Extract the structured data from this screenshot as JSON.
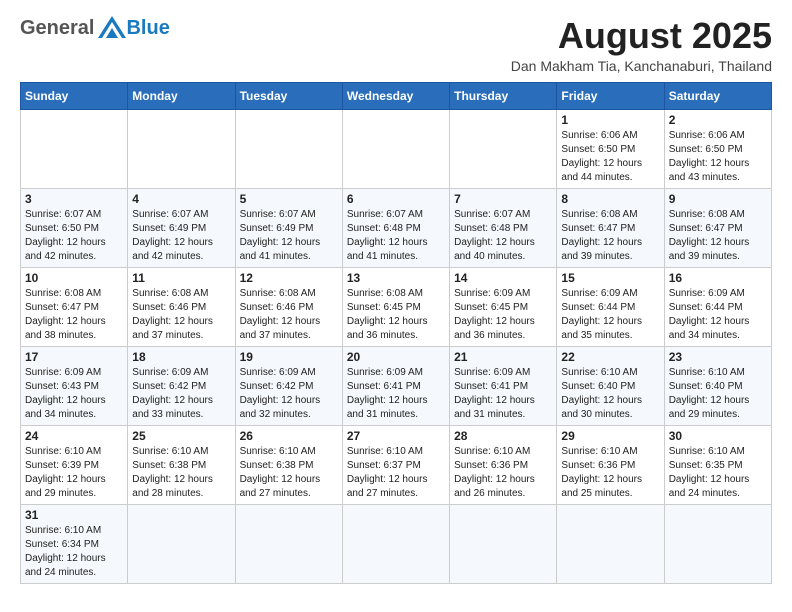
{
  "logo": {
    "general": "General",
    "blue": "Blue"
  },
  "header": {
    "month": "August 2025",
    "subtitle": "Dan Makham Tia, Kanchanaburi, Thailand"
  },
  "weekdays": [
    "Sunday",
    "Monday",
    "Tuesday",
    "Wednesday",
    "Thursday",
    "Friday",
    "Saturday"
  ],
  "weeks": [
    [
      {
        "day": "",
        "info": ""
      },
      {
        "day": "",
        "info": ""
      },
      {
        "day": "",
        "info": ""
      },
      {
        "day": "",
        "info": ""
      },
      {
        "day": "",
        "info": ""
      },
      {
        "day": "1",
        "info": "Sunrise: 6:06 AM\nSunset: 6:50 PM\nDaylight: 12 hours\nand 44 minutes."
      },
      {
        "day": "2",
        "info": "Sunrise: 6:06 AM\nSunset: 6:50 PM\nDaylight: 12 hours\nand 43 minutes."
      }
    ],
    [
      {
        "day": "3",
        "info": "Sunrise: 6:07 AM\nSunset: 6:50 PM\nDaylight: 12 hours\nand 42 minutes."
      },
      {
        "day": "4",
        "info": "Sunrise: 6:07 AM\nSunset: 6:49 PM\nDaylight: 12 hours\nand 42 minutes."
      },
      {
        "day": "5",
        "info": "Sunrise: 6:07 AM\nSunset: 6:49 PM\nDaylight: 12 hours\nand 41 minutes."
      },
      {
        "day": "6",
        "info": "Sunrise: 6:07 AM\nSunset: 6:48 PM\nDaylight: 12 hours\nand 41 minutes."
      },
      {
        "day": "7",
        "info": "Sunrise: 6:07 AM\nSunset: 6:48 PM\nDaylight: 12 hours\nand 40 minutes."
      },
      {
        "day": "8",
        "info": "Sunrise: 6:08 AM\nSunset: 6:47 PM\nDaylight: 12 hours\nand 39 minutes."
      },
      {
        "day": "9",
        "info": "Sunrise: 6:08 AM\nSunset: 6:47 PM\nDaylight: 12 hours\nand 39 minutes."
      }
    ],
    [
      {
        "day": "10",
        "info": "Sunrise: 6:08 AM\nSunset: 6:47 PM\nDaylight: 12 hours\nand 38 minutes."
      },
      {
        "day": "11",
        "info": "Sunrise: 6:08 AM\nSunset: 6:46 PM\nDaylight: 12 hours\nand 37 minutes."
      },
      {
        "day": "12",
        "info": "Sunrise: 6:08 AM\nSunset: 6:46 PM\nDaylight: 12 hours\nand 37 minutes."
      },
      {
        "day": "13",
        "info": "Sunrise: 6:08 AM\nSunset: 6:45 PM\nDaylight: 12 hours\nand 36 minutes."
      },
      {
        "day": "14",
        "info": "Sunrise: 6:09 AM\nSunset: 6:45 PM\nDaylight: 12 hours\nand 36 minutes."
      },
      {
        "day": "15",
        "info": "Sunrise: 6:09 AM\nSunset: 6:44 PM\nDaylight: 12 hours\nand 35 minutes."
      },
      {
        "day": "16",
        "info": "Sunrise: 6:09 AM\nSunset: 6:44 PM\nDaylight: 12 hours\nand 34 minutes."
      }
    ],
    [
      {
        "day": "17",
        "info": "Sunrise: 6:09 AM\nSunset: 6:43 PM\nDaylight: 12 hours\nand 34 minutes."
      },
      {
        "day": "18",
        "info": "Sunrise: 6:09 AM\nSunset: 6:42 PM\nDaylight: 12 hours\nand 33 minutes."
      },
      {
        "day": "19",
        "info": "Sunrise: 6:09 AM\nSunset: 6:42 PM\nDaylight: 12 hours\nand 32 minutes."
      },
      {
        "day": "20",
        "info": "Sunrise: 6:09 AM\nSunset: 6:41 PM\nDaylight: 12 hours\nand 31 minutes."
      },
      {
        "day": "21",
        "info": "Sunrise: 6:09 AM\nSunset: 6:41 PM\nDaylight: 12 hours\nand 31 minutes."
      },
      {
        "day": "22",
        "info": "Sunrise: 6:10 AM\nSunset: 6:40 PM\nDaylight: 12 hours\nand 30 minutes."
      },
      {
        "day": "23",
        "info": "Sunrise: 6:10 AM\nSunset: 6:40 PM\nDaylight: 12 hours\nand 29 minutes."
      }
    ],
    [
      {
        "day": "24",
        "info": "Sunrise: 6:10 AM\nSunset: 6:39 PM\nDaylight: 12 hours\nand 29 minutes."
      },
      {
        "day": "25",
        "info": "Sunrise: 6:10 AM\nSunset: 6:38 PM\nDaylight: 12 hours\nand 28 minutes."
      },
      {
        "day": "26",
        "info": "Sunrise: 6:10 AM\nSunset: 6:38 PM\nDaylight: 12 hours\nand 27 minutes."
      },
      {
        "day": "27",
        "info": "Sunrise: 6:10 AM\nSunset: 6:37 PM\nDaylight: 12 hours\nand 27 minutes."
      },
      {
        "day": "28",
        "info": "Sunrise: 6:10 AM\nSunset: 6:36 PM\nDaylight: 12 hours\nand 26 minutes."
      },
      {
        "day": "29",
        "info": "Sunrise: 6:10 AM\nSunset: 6:36 PM\nDaylight: 12 hours\nand 25 minutes."
      },
      {
        "day": "30",
        "info": "Sunrise: 6:10 AM\nSunset: 6:35 PM\nDaylight: 12 hours\nand 24 minutes."
      }
    ],
    [
      {
        "day": "31",
        "info": "Sunrise: 6:10 AM\nSunset: 6:34 PM\nDaylight: 12 hours\nand 24 minutes."
      },
      {
        "day": "",
        "info": ""
      },
      {
        "day": "",
        "info": ""
      },
      {
        "day": "",
        "info": ""
      },
      {
        "day": "",
        "info": ""
      },
      {
        "day": "",
        "info": ""
      },
      {
        "day": "",
        "info": ""
      }
    ]
  ]
}
